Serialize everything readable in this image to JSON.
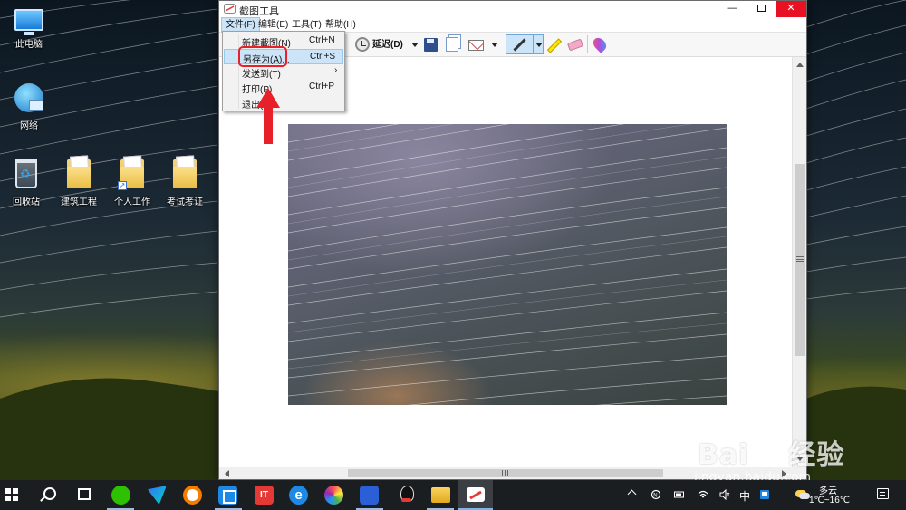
{
  "desktop": {
    "icons": [
      {
        "label": "此电脑",
        "icon": "computer-icon"
      },
      {
        "label": "网络",
        "icon": "network-icon"
      },
      {
        "label": "回收站",
        "icon": "recycle-bin-icon"
      },
      {
        "label": "建筑工程",
        "icon": "folder-icon"
      },
      {
        "label": "个人工作",
        "icon": "folder-shortcut-icon"
      },
      {
        "label": "考试考证",
        "icon": "folder-icon"
      }
    ]
  },
  "window": {
    "title": "截图工具",
    "controls": {
      "minimize": "—",
      "close": "✕"
    },
    "menu": [
      "文件(F)",
      "编辑(E)",
      "工具(T)",
      "帮助(H)"
    ],
    "active_menu": "文件(F)",
    "toolbar": {
      "delay_label": "延迟(D)",
      "icons": [
        "clock-icon",
        "save-icon",
        "copy-icon",
        "send-snip-icon",
        "pen-icon",
        "highlighter-icon",
        "eraser-icon",
        "paint3d-icon"
      ],
      "selected_tool": "pen-icon"
    }
  },
  "file_menu": {
    "items": [
      {
        "label": "新建截图(N)",
        "shortcut": "Ctrl+N",
        "submenu": ""
      },
      {
        "label": "另存为(A)...",
        "shortcut": "Ctrl+S",
        "submenu": "",
        "highlighted": true
      },
      {
        "label": "发送到(T)",
        "shortcut": "",
        "submenu": "›"
      },
      {
        "label": "打印(P)",
        "shortcut": "Ctrl+P",
        "submenu": ""
      },
      {
        "label": "退出(X)",
        "shortcut": "",
        "submenu": ""
      }
    ]
  },
  "annotation": {
    "color": "#e8202a",
    "target": "另存为(A)..."
  },
  "watermark": {
    "brand": "Bai",
    "brand2": "经验",
    "url": "jingyan.baidu.com"
  },
  "taskbar": {
    "apps": [
      "wechat-icon",
      "feishu-icon",
      "ohayo-icon",
      "app-grid-icon",
      "it-icon",
      "ie-icon",
      "photos-icon",
      "baidu-icon",
      "qq-icon",
      "file-explorer-icon",
      "snipping-tool-icon"
    ],
    "active_app": "snipping-tool-icon",
    "tray": {
      "input_mode": "中",
      "weather_condition": "多云",
      "temperature": "1℃~16℃"
    }
  }
}
